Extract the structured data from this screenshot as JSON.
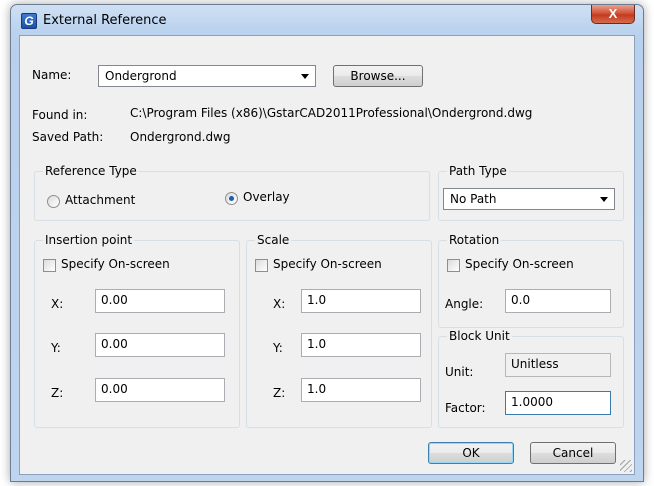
{
  "window": {
    "title": "External Reference",
    "close_glyph": "X"
  },
  "name": {
    "label": "Name:",
    "value": "Ondergrond",
    "browse_label": "Browse..."
  },
  "found_in": {
    "label": "Found in:",
    "value": "C:\\Program Files (x86)\\GstarCAD2011Professional\\Ondergrond.dwg"
  },
  "saved_path": {
    "label": "Saved Path:",
    "value": "Ondergrond.dwg"
  },
  "reference_type": {
    "title": "Reference Type",
    "attachment_label": "Attachment",
    "overlay_label": "Overlay",
    "selected": "Overlay"
  },
  "path_type": {
    "title": "Path Type",
    "value": "No Path"
  },
  "insertion": {
    "title": "Insertion point",
    "specify_label": "Specify On-screen",
    "x_label": "X:",
    "x": "0.00",
    "y_label": "Y:",
    "y": "0.00",
    "z_label": "Z:",
    "z": "0.00"
  },
  "scale": {
    "title": "Scale",
    "specify_label": "Specify On-screen",
    "x_label": "X:",
    "x": "1.0",
    "y_label": "Y:",
    "y": "1.0",
    "z_label": "Z:",
    "z": "1.0"
  },
  "rotation": {
    "title": "Rotation",
    "specify_label": "Specify On-screen",
    "angle_label": "Angle:",
    "angle": "0.0"
  },
  "block_unit": {
    "title": "Block Unit",
    "unit_label": "Unit:",
    "unit": "Unitless",
    "factor_label": "Factor:",
    "factor": "1.0000"
  },
  "buttons": {
    "ok": "OK",
    "cancel": "Cancel"
  }
}
